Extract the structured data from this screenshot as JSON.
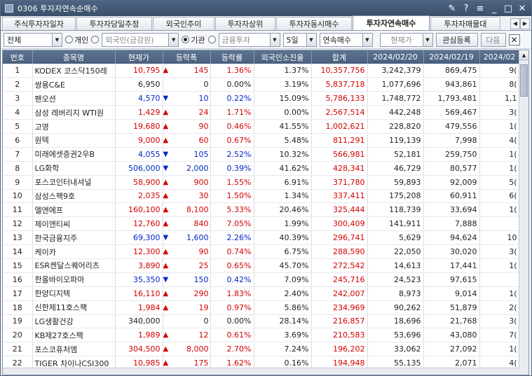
{
  "window": {
    "title": "0306 투자자연속순매수"
  },
  "tabs": [
    {
      "label": "주식투자자일자",
      "active": false
    },
    {
      "label": "투자자당일추정",
      "active": false
    },
    {
      "label": "외국인추이",
      "active": false
    },
    {
      "label": "투자자상위",
      "active": false
    },
    {
      "label": "투자자동시매수",
      "active": false
    },
    {
      "label": "투자자연속매수",
      "active": true
    },
    {
      "label": "투자자매물대",
      "active": false
    }
  ],
  "toolbar": {
    "market": "전체",
    "radio_individual": "개인",
    "radio_foreign": "외국인(금감원)",
    "radio_institution": "기관",
    "investor_combo": "금융투자",
    "period": "5일",
    "mode": "연속매수",
    "price_combo": "현재가",
    "watch_btn": "관심등록",
    "next_btn": "다음"
  },
  "columns": [
    "번호",
    "종목명",
    "현재가",
    "등락폭",
    "등락률",
    "외국인소진율",
    "합계",
    "2024/02/20",
    "2024/02/19",
    "2024/02"
  ],
  "rows": [
    {
      "no": "1",
      "name": "KODEX 코스닥150레",
      "price": "10,795",
      "dir": "up",
      "chg": "145",
      "rate": "1.36%",
      "foreign": "1.37%",
      "sum": "10,357,756",
      "d1": "3,242,379",
      "d2": "869,475",
      "d3": "9("
    },
    {
      "no": "2",
      "name": "쌍용C&E",
      "price": "6,950",
      "dir": "flat",
      "chg": "0",
      "rate": "0.00%",
      "foreign": "3.19%",
      "sum": "5,837,718",
      "d1": "1,077,696",
      "d2": "943,861",
      "d3": "8("
    },
    {
      "no": "3",
      "name": "팬오션",
      "price": "4,570",
      "dir": "dn",
      "chg": "10",
      "rate": "0.22%",
      "foreign": "15.09%",
      "sum": "5,786,133",
      "d1": "1,748,772",
      "d2": "1,793,481",
      "d3": "1,1"
    },
    {
      "no": "4",
      "name": "삼성 레버리지 WTI원",
      "price": "1,429",
      "dir": "up",
      "chg": "24",
      "rate": "1.71%",
      "foreign": "0.00%",
      "sum": "2,567,514",
      "d1": "442,248",
      "d2": "569,467",
      "d3": "3("
    },
    {
      "no": "5",
      "name": "고영",
      "price": "19,680",
      "dir": "up",
      "chg": "90",
      "rate": "0.46%",
      "foreign": "41.55%",
      "sum": "1,002,621",
      "d1": "228,820",
      "d2": "479,556",
      "d3": "1("
    },
    {
      "no": "6",
      "name": "원텍",
      "price": "9,000",
      "dir": "up",
      "chg": "60",
      "rate": "0.67%",
      "foreign": "5.48%",
      "sum": "811,291",
      "d1": "119,139",
      "d2": "7,998",
      "d3": "4("
    },
    {
      "no": "7",
      "name": "미래에셋증권2우B",
      "price": "4,055",
      "dir": "dn",
      "chg": "105",
      "rate": "2.52%",
      "foreign": "10.32%",
      "sum": "566,981",
      "d1": "52,181",
      "d2": "259,750",
      "d3": "1("
    },
    {
      "no": "8",
      "name": "LG화학",
      "price": "506,000",
      "dir": "dn",
      "chg": "2,000",
      "rate": "0.39%",
      "foreign": "41.62%",
      "sum": "428,341",
      "d1": "46,729",
      "d2": "80,577",
      "d3": "1("
    },
    {
      "no": "9",
      "name": "포스코인터내셔널",
      "price": "58,900",
      "dir": "up",
      "chg": "900",
      "rate": "1.55%",
      "foreign": "6.91%",
      "sum": "371,780",
      "d1": "59,893",
      "d2": "92,009",
      "d3": "5("
    },
    {
      "no": "10",
      "name": "삼성스팩9호",
      "price": "2,035",
      "dir": "up",
      "chg": "30",
      "rate": "1.50%",
      "foreign": "1.34%",
      "sum": "337,411",
      "d1": "175,208",
      "d2": "60,911",
      "d3": "6("
    },
    {
      "no": "11",
      "name": "엘앤에프",
      "price": "160,100",
      "dir": "up",
      "chg": "8,100",
      "rate": "5.33%",
      "foreign": "20.46%",
      "sum": "325,444",
      "d1": "118,739",
      "d2": "33,694",
      "d3": "1("
    },
    {
      "no": "12",
      "name": "제이앤티씨",
      "price": "12,760",
      "dir": "up",
      "chg": "840",
      "rate": "7.05%",
      "foreign": "1.99%",
      "sum": "300,409",
      "d1": "141,911",
      "d2": "7,888",
      "d3": ""
    },
    {
      "no": "13",
      "name": "한국금융지주",
      "price": "69,300",
      "dir": "dn",
      "chg": "1,600",
      "rate": "2.26%",
      "foreign": "40.39%",
      "sum": "296,741",
      "d1": "5,629",
      "d2": "94,624",
      "d3": "10"
    },
    {
      "no": "14",
      "name": "케이카",
      "price": "12,300",
      "dir": "up",
      "chg": "90",
      "rate": "0.74%",
      "foreign": "6.75%",
      "sum": "288,590",
      "d1": "22,050",
      "d2": "30,020",
      "d3": "3("
    },
    {
      "no": "15",
      "name": "ESR켄달스퀘어리츠",
      "price": "3,890",
      "dir": "up",
      "chg": "25",
      "rate": "0.65%",
      "foreign": "45.70%",
      "sum": "272,542",
      "d1": "14,613",
      "d2": "17,441",
      "d3": "1("
    },
    {
      "no": "16",
      "name": "한올바이오파마",
      "price": "35,350",
      "dir": "dn",
      "chg": "150",
      "rate": "0.42%",
      "foreign": "7.09%",
      "sum": "245,716",
      "d1": "24,523",
      "d2": "97,615",
      "d3": ""
    },
    {
      "no": "17",
      "name": "한양디지텍",
      "price": "16,110",
      "dir": "up",
      "chg": "290",
      "rate": "1.83%",
      "foreign": "2.40%",
      "sum": "242,007",
      "d1": "8,973",
      "d2": "9,014",
      "d3": "1("
    },
    {
      "no": "18",
      "name": "신한제11호스팩",
      "price": "1,984",
      "dir": "up",
      "chg": "19",
      "rate": "0.97%",
      "foreign": "5.86%",
      "sum": "234,969",
      "d1": "90,262",
      "d2": "51,879",
      "d3": "2("
    },
    {
      "no": "19",
      "name": "LG생활건강",
      "price": "340,000",
      "dir": "flat",
      "chg": "0",
      "rate": "0.00%",
      "foreign": "28.14%",
      "sum": "216,857",
      "d1": "18,696",
      "d2": "21,768",
      "d3": "3("
    },
    {
      "no": "20",
      "name": "KB제27호스팩",
      "price": "1,989",
      "dir": "up",
      "chg": "12",
      "rate": "0.61%",
      "foreign": "3.69%",
      "sum": "210,583",
      "d1": "53,696",
      "d2": "43,080",
      "d3": "7("
    },
    {
      "no": "21",
      "name": "포스코퓨처엠",
      "price": "304,500",
      "dir": "up",
      "chg": "8,000",
      "rate": "2.70%",
      "foreign": "7.24%",
      "sum": "196,202",
      "d1": "33,062",
      "d2": "27,092",
      "d3": "1("
    },
    {
      "no": "22",
      "name": "TIGER 차이나CSI300",
      "price": "10,985",
      "dir": "up",
      "chg": "175",
      "rate": "1.62%",
      "foreign": "0.16%",
      "sum": "194,948",
      "d1": "55,135",
      "d2": "2,071",
      "d3": "4("
    }
  ]
}
